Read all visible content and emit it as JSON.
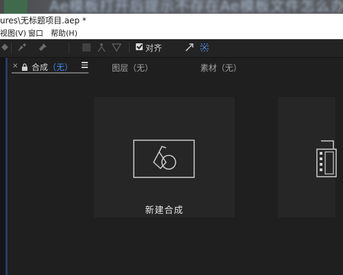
{
  "overlay": {
    "text": "Ae模板打开后提示不存在Ae模板文件怎么办"
  },
  "window": {
    "title": "ures\\无标题项目.aep *"
  },
  "menu": {
    "items": [
      {
        "label": "视图(V)"
      },
      {
        "label": "窗口"
      },
      {
        "label": "帮助(H)"
      }
    ]
  },
  "toolbar": {
    "align_label": "对齐",
    "align_checked": true,
    "icons": [
      "pin-icon",
      "pen-icon",
      "pin-tool-icon",
      "shape-icon",
      "puppet-icon",
      "puppet-alt-icon",
      "expand-icon",
      "snap-icon"
    ]
  },
  "panel": {
    "tabs": [
      {
        "label": "合成",
        "suffix": "（无）",
        "active": true
      },
      {
        "label": "图层（无）",
        "active": false
      },
      {
        "label": "素材（无）",
        "active": false
      }
    ],
    "accent": "#3f8cf0"
  },
  "cards": {
    "new_composition": {
      "label": "新建合成",
      "icon": "composition-icon"
    },
    "from_footage": {
      "icon": "film-strip-icon"
    }
  }
}
